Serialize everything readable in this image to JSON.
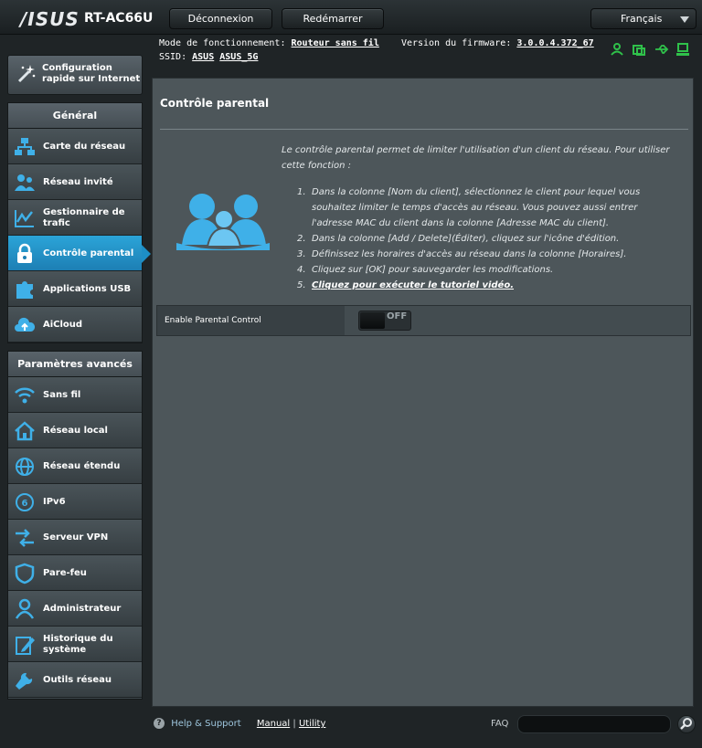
{
  "header": {
    "brand": "/ISUS",
    "model": "RT-AC66U",
    "logout_label": "Déconnexion",
    "reboot_label": "Redémarrer",
    "language": "Français"
  },
  "info": {
    "mode_label": "Mode de fonctionnement:",
    "mode_value": "Routeur sans fil",
    "firmware_label": "Version du firmware:",
    "firmware_value": "3.0.0.4.372_67",
    "ssid_label": "SSID:",
    "ssid_1": "ASUS",
    "ssid_2": "ASUS_5G"
  },
  "sidebar": {
    "quick_setup": "Configuration rapide sur Internet",
    "general_title": "Général",
    "general_items": [
      {
        "label": "Carte du réseau",
        "icon": "network-map-icon"
      },
      {
        "label": "Réseau invité",
        "icon": "guest-network-icon"
      },
      {
        "label": "Gestionnaire de trafic",
        "icon": "traffic-manager-icon"
      },
      {
        "label": "Contrôle parental",
        "icon": "parental-control-icon"
      },
      {
        "label": "Applications USB",
        "icon": "usb-apps-icon"
      },
      {
        "label": "AiCloud",
        "icon": "aicloud-icon"
      }
    ],
    "advanced_title": "Paramètres avancés",
    "advanced_items": [
      {
        "label": "Sans fil",
        "icon": "wireless-icon"
      },
      {
        "label": "Réseau local",
        "icon": "lan-icon"
      },
      {
        "label": "Réseau étendu",
        "icon": "wan-icon"
      },
      {
        "label": "IPv6",
        "icon": "ipv6-icon"
      },
      {
        "label": "Serveur VPN",
        "icon": "vpn-icon"
      },
      {
        "label": "Pare-feu",
        "icon": "firewall-icon"
      },
      {
        "label": "Administrateur",
        "icon": "administrator-icon"
      },
      {
        "label": "Historique du système",
        "icon": "system-log-icon"
      },
      {
        "label": "Outils réseau",
        "icon": "network-tools-icon"
      }
    ]
  },
  "main": {
    "title": "Contrôle parental",
    "intro": "Le contrôle parental permet de limiter l'utilisation d'un client du réseau. Pour utiliser cette fonction :",
    "steps": [
      {
        "num": "1.",
        "text": "Dans la colonne [Nom du client], sélectionnez le client pour lequel vous souhaitez limiter le temps d'accès au réseau. Vous pouvez aussi entrer l'adresse MAC du client dans la colonne [Adresse MAC du client]."
      },
      {
        "num": "2.",
        "text": "Dans la colonne [Add / Delete](Éditer), cliquez sur l'icône d'édition."
      },
      {
        "num": "3.",
        "text": "Définissez les horaires d'accès au réseau dans la colonne [Horaires]."
      },
      {
        "num": "4.",
        "text": "Cliquez sur [OK] pour sauvegarder les modifications."
      }
    ],
    "step5_num": "5.",
    "step5_link": "Cliquez pour exécuter le tutoriel vidéo.",
    "setting_label": "Enable Parental Control",
    "toggle_state": "OFF"
  },
  "footer": {
    "help": "Help & Support",
    "manual": "Manual",
    "separator": "|",
    "utility": "Utility",
    "faq": "FAQ",
    "search_value": ""
  },
  "colors": {
    "accent": "#1d8fc6",
    "icon_blue": "#3fb0e8",
    "status_green": "#2fc14a"
  }
}
